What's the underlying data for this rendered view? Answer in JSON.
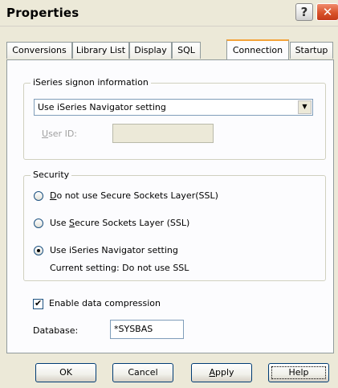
{
  "window": {
    "title": "Properties",
    "help_glyph": "?",
    "close_glyph": "✕"
  },
  "tabs": [
    {
      "label": "Conversions",
      "active": false
    },
    {
      "label": "Library List",
      "active": false
    },
    {
      "label": "Display",
      "active": false
    },
    {
      "label": "SQL",
      "active": false
    },
    {
      "label": "Connection",
      "active": true
    },
    {
      "label": "Startup",
      "active": false
    }
  ],
  "signon": {
    "group_label": "iSeries signon information",
    "dropdown_value": "Use iSeries Navigator setting",
    "userid_label_pre": "",
    "userid_label_mnemonic": "U",
    "userid_label_post": "ser ID:",
    "userid_value": ""
  },
  "security": {
    "group_label": "Security",
    "option1_pre": "",
    "option1_mnemonic": "D",
    "option1_post": "o not use Secure Sockets Layer(SSL)",
    "option2_pre": "Use ",
    "option2_mnemonic": "S",
    "option2_post": "ecure Sockets Layer (SSL)",
    "option3": "Use iSeries Navigator setting",
    "selected": 3,
    "current_setting": "Current setting:  Do not use SSL"
  },
  "compression": {
    "label": "Enable data compression",
    "checked": true
  },
  "database": {
    "label": "Database:",
    "value": "*SYSBAS"
  },
  "buttons": {
    "ok": "OK",
    "cancel": "Cancel",
    "apply_mnemonic": "A",
    "apply_post": "pply",
    "help": "Help"
  },
  "colors": {
    "accent_tab": "#f3a33a",
    "close_button": "#d9532b",
    "dialog_bg": "#ece9d8"
  }
}
